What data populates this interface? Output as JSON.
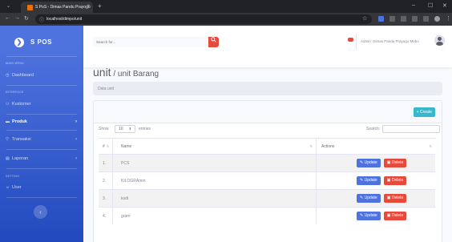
{
  "browser": {
    "tab_title": "S PoS - Dimas Pandu Prayogo",
    "url": "localhost/dimpo/unit",
    "new_tab": "+",
    "close": "×"
  },
  "sidebar": {
    "brand": "S POS",
    "headings": [
      "MAIN MENU",
      "INTERFACE",
      "SETTING"
    ],
    "items": [
      {
        "label": "Dashboard",
        "icon": "dashboard-icon",
        "glyph": "◷"
      },
      {
        "label": "Kustomer",
        "icon": "users-icon",
        "glyph": "⚇"
      },
      {
        "label": "Produk",
        "icon": "product-icon",
        "glyph": "▬",
        "active": true
      },
      {
        "label": "Transaksi",
        "icon": "cart-icon",
        "glyph": "▽"
      },
      {
        "label": "Laporan",
        "icon": "report-icon",
        "glyph": "▤"
      },
      {
        "label": "User",
        "icon": "user-icon",
        "glyph": "☺"
      }
    ],
    "toggle": "‹"
  },
  "topbar": {
    "search_placeholder": "Search for...",
    "search_icon": "search-icon",
    "user_name": "Admin: Dimas Pandu Prayogo  Mebo"
  },
  "page": {
    "title_main": "unit",
    "title_sub": " / unit Barang",
    "breadcrumb": "Data unit",
    "create_label": "+ Create"
  },
  "datatable": {
    "show_label": "Show",
    "entries_value": "10",
    "entries_label": "entries",
    "search_label": "Search:"
  },
  "table": {
    "columns": [
      "#",
      "Name",
      "Actions"
    ],
    "rows": [
      {
        "no": "1.",
        "name": "PCS"
      },
      {
        "no": "2.",
        "name": "KILOGRAmm"
      },
      {
        "no": "3.",
        "name": "kodi"
      },
      {
        "no": "4.",
        "name": "gram"
      }
    ],
    "update_label": "Update",
    "delete_label": "Delete"
  },
  "colors": {
    "primary": "#4e73df",
    "danger": "#e74a3b",
    "info": "#36b9cc"
  }
}
